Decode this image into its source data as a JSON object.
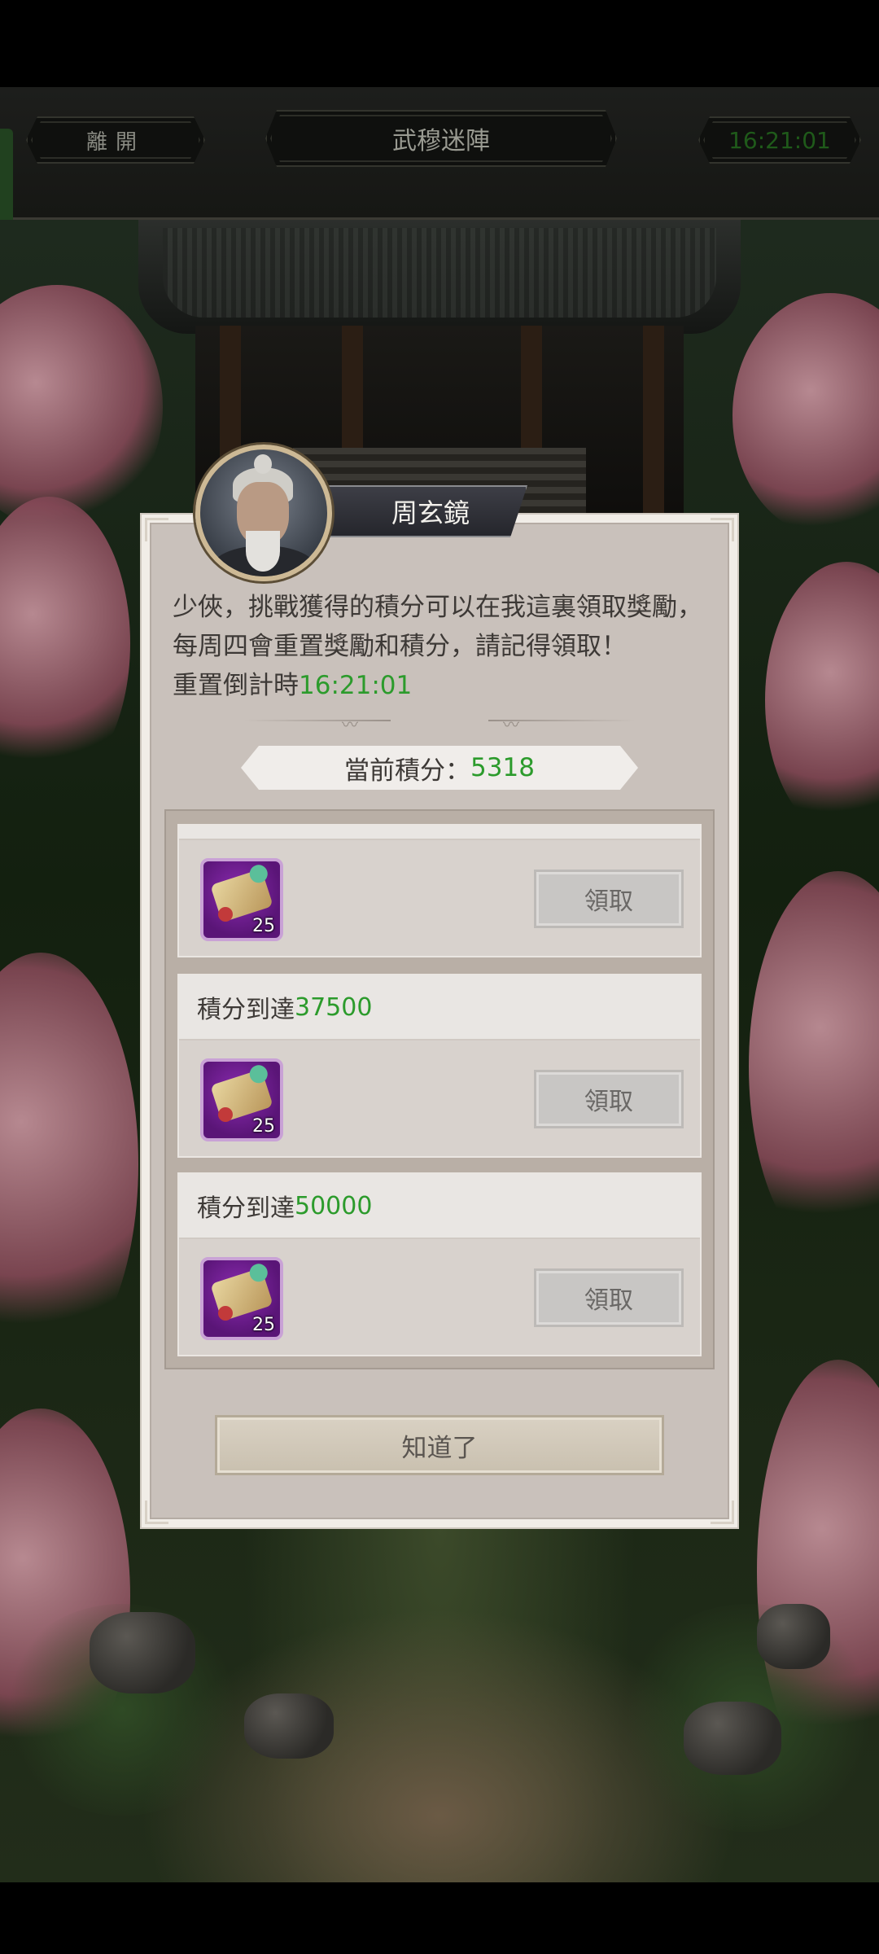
{
  "header": {
    "leave_label": "離開",
    "title": "武穆迷陣",
    "timer": "16:21:01"
  },
  "dialog": {
    "npc_name": "周玄鏡",
    "intro_text": "少俠，挑戰獲得的積分可以在我這裏領取獎勵，每周四會重置獎勵和積分，請記得領取！",
    "reset_prefix": "重置倒計時",
    "reset_countdown": "16:21:01",
    "points_label": "當前積分：",
    "points_value": "5318",
    "rewards": [
      {
        "threshold_prefix": "",
        "threshold_value": "",
        "item_icon": "scroll-item-icon",
        "quantity": "25",
        "claim_label": "領取"
      },
      {
        "threshold_prefix": "積分到達",
        "threshold_value": "37500",
        "item_icon": "scroll-item-icon",
        "quantity": "25",
        "claim_label": "領取"
      },
      {
        "threshold_prefix": "積分到達",
        "threshold_value": "50000",
        "item_icon": "scroll-item-icon",
        "quantity": "25",
        "claim_label": "領取"
      }
    ],
    "ok_label": "知道了"
  },
  "colors": {
    "highlight_green": "#2c9b2c",
    "item_purple": "#7a22a0",
    "dialog_bg": "#c9c1bb"
  }
}
